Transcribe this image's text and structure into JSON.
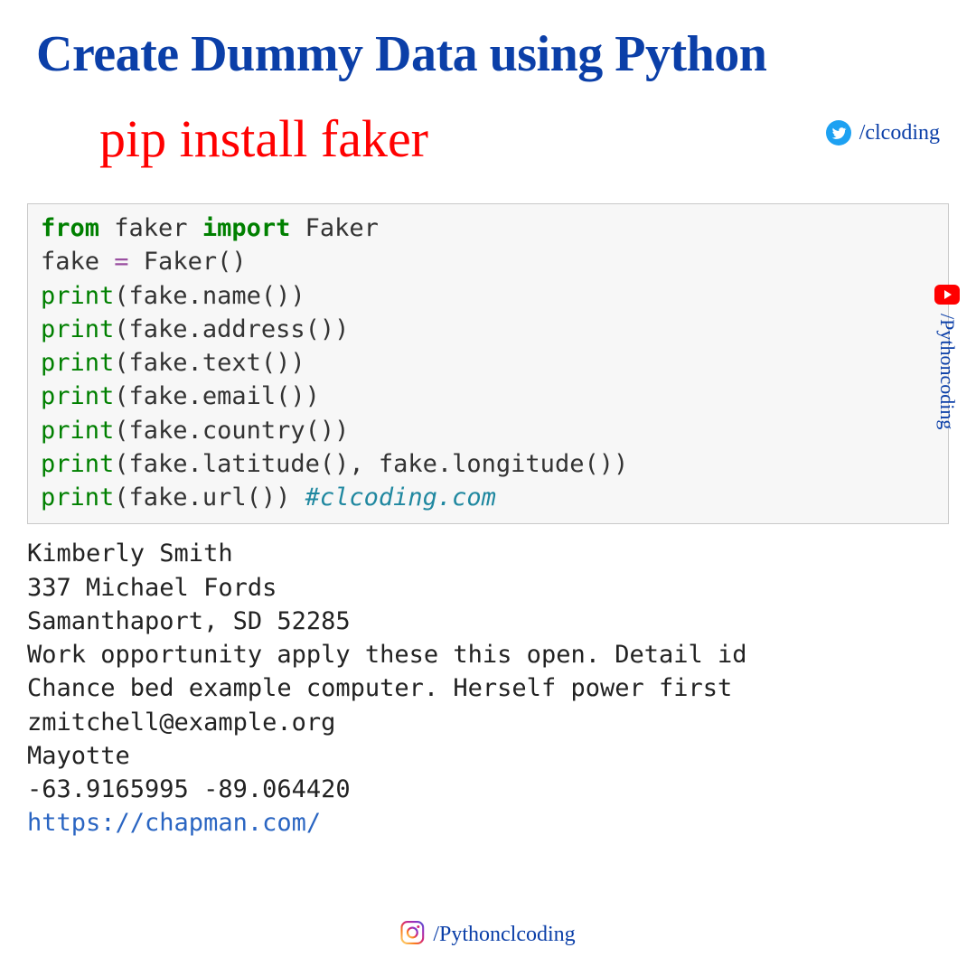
{
  "title": "Create Dummy Data using Python",
  "pip_command": "pip install faker",
  "twitter": {
    "handle": "/clcoding"
  },
  "youtube": {
    "handle": "/Pythoncoding"
  },
  "instagram": {
    "handle": "/Pythonclcoding"
  },
  "code": {
    "line1": {
      "kw1": "from",
      "t1": " faker ",
      "kw2": "import",
      "t2": " Faker"
    },
    "line2": {
      "a": "fake ",
      "op": "=",
      "b": " Faker()"
    },
    "line3": {
      "fn": "print",
      "rest": "(fake.name())"
    },
    "line4": {
      "fn": "print",
      "rest": "(fake.address())"
    },
    "line5": {
      "fn": "print",
      "rest": "(fake.text())"
    },
    "line6": {
      "fn": "print",
      "rest": "(fake.email())"
    },
    "line7": {
      "fn": "print",
      "rest": "(fake.country())"
    },
    "line8": {
      "fn": "print",
      "rest": "(fake.latitude(), fake.longitude())"
    },
    "line9": {
      "fn": "print",
      "rest": "(fake.url()) ",
      "comment": "#clcoding.com"
    }
  },
  "output": {
    "line1": "Kimberly Smith",
    "line2": "337 Michael Fords",
    "line3": "Samanthaport, SD 52285",
    "line4": "Work opportunity apply these this open. Detail id",
    "line5": "Chance bed example computer. Herself power first",
    "line6": "zmitchell@example.org",
    "line7": "Mayotte",
    "line8": "-63.9165995 -89.064420",
    "link": "https://chapman.com/"
  }
}
